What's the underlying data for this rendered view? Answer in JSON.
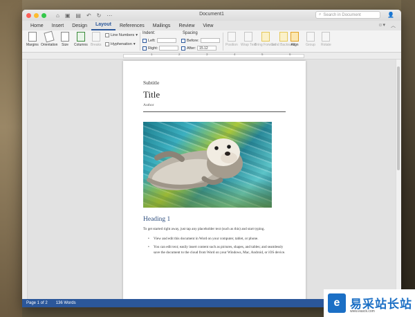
{
  "window": {
    "document_title": "Document1",
    "search_placeholder": "Search in Document"
  },
  "tabs": [
    "Home",
    "Insert",
    "Design",
    "Layout",
    "References",
    "Mailings",
    "Review",
    "View"
  ],
  "active_tab": "Layout",
  "ribbon": {
    "margins": "Margins",
    "orientation": "Orientation",
    "size": "Size",
    "columns": "Columns",
    "breaks": "Breaks",
    "line_numbers": "Line Numbers",
    "hyphenation": "Hyphenation",
    "indent_label": "Indent:",
    "indent_left_label": "Left:",
    "indent_right_label": "Right:",
    "spacing_label": "Spacing",
    "spacing_before_label": "Before:",
    "spacing_after_label": "After:",
    "spacing_after_value": "15.12",
    "position": "Position",
    "wrap_text": "Wrap Text",
    "bring_forward": "Bring Forward",
    "send_backward": "Send Backward",
    "align": "Align",
    "group": "Group",
    "rotate": "Rotate"
  },
  "document": {
    "subtitle": "Subtitle",
    "title": "Title",
    "author": "Author",
    "heading1": "Heading 1",
    "body": "To get started right away, just tap any placeholder text (such as this) and start typing.",
    "bullets": [
      "View and edit this document in Word on your computer, tablet, or phone.",
      "You can edit text; easily insert content such as pictures, shapes, and tables; and seamlessly save the document to the cloud from Word on your Windows, Mac, Android, or iOS device."
    ]
  },
  "status": {
    "page": "Page 1 of 2",
    "words": "136 Words"
  },
  "watermark": {
    "name": "易采站长站",
    "url": "www.easck.com"
  },
  "colors": {
    "accent": "#2b579a",
    "heading": "#2e4e7e"
  }
}
